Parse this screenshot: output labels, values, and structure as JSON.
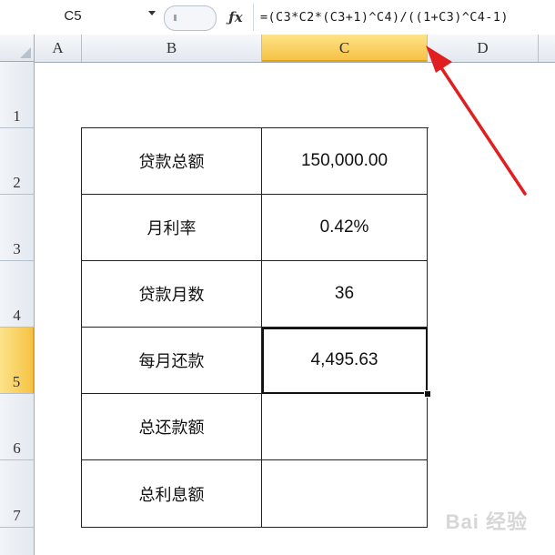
{
  "formula_bar": {
    "name_box": "C5",
    "fx_label": "fx",
    "formula": "=(C3*C2*(C3+1)^C4)/((1+C3)^C4-1)"
  },
  "columns": [
    {
      "label": "A",
      "active": false
    },
    {
      "label": "B",
      "active": false
    },
    {
      "label": "C",
      "active": true
    },
    {
      "label": "D",
      "active": false
    }
  ],
  "rows": [
    {
      "label": "1",
      "active": false
    },
    {
      "label": "2",
      "active": false
    },
    {
      "label": "3",
      "active": false
    },
    {
      "label": "4",
      "active": false
    },
    {
      "label": "5",
      "active": true
    },
    {
      "label": "6",
      "active": false
    },
    {
      "label": "7",
      "active": false
    }
  ],
  "table": [
    {
      "label": "贷款总额",
      "value": "150,000.00"
    },
    {
      "label": "月利率",
      "value": "0.42%"
    },
    {
      "label": "贷款月数",
      "value": "36"
    },
    {
      "label": "每月还款",
      "value": "4,495.63"
    },
    {
      "label": "总还款额",
      "value": ""
    },
    {
      "label": "总利息额",
      "value": ""
    }
  ],
  "selected_cell": "C5",
  "colors": {
    "active_header": "#f6c244",
    "annotation_arrow": "#e02020"
  },
  "icons": {
    "fx": "function-icon",
    "dropdown": "chevron-down-icon"
  },
  "watermark": "Bai 经验"
}
